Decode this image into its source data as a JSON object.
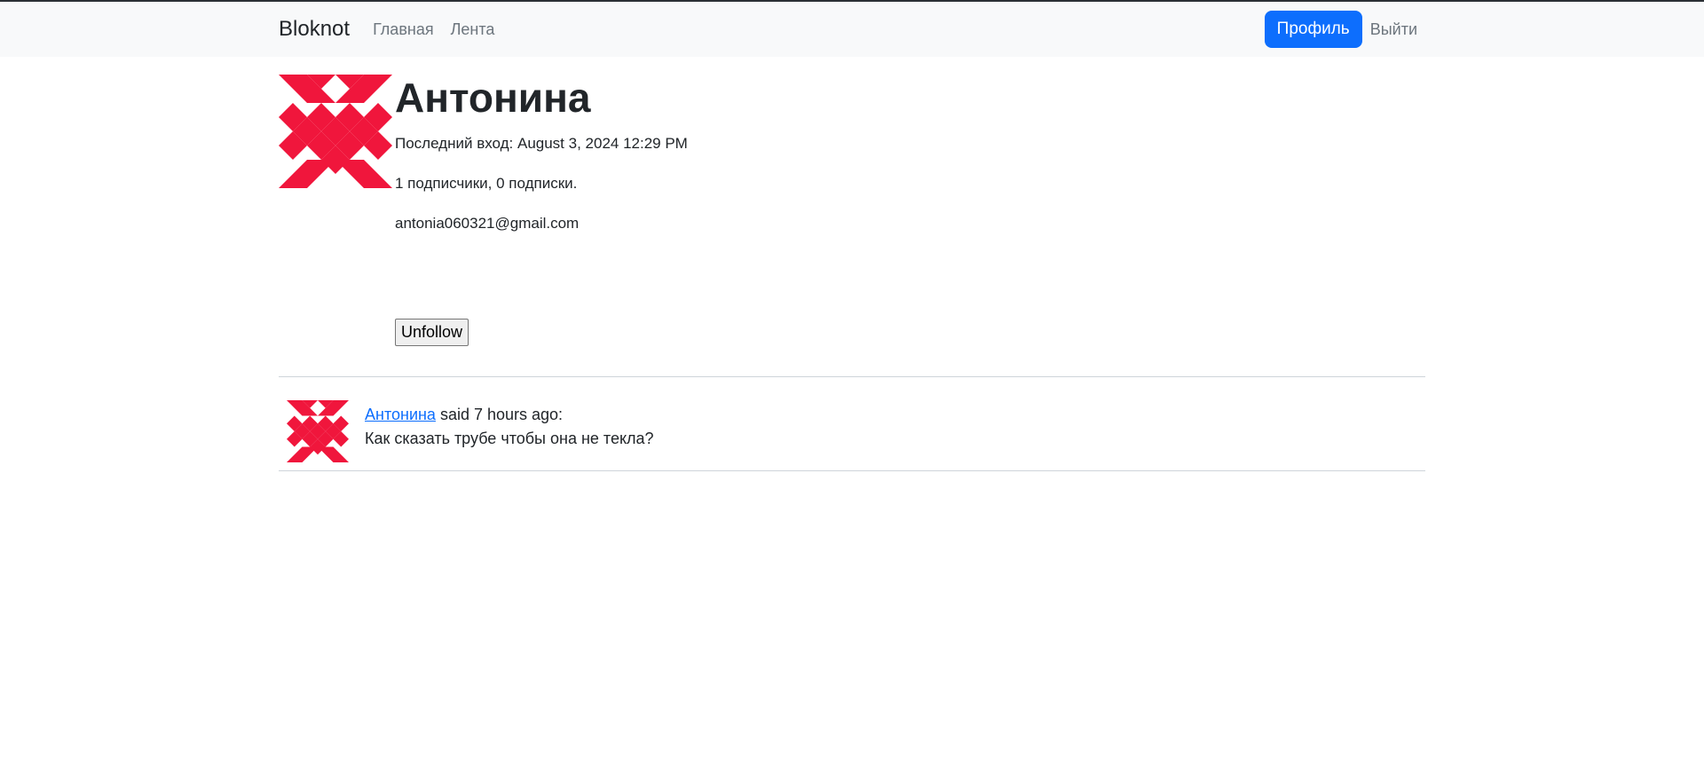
{
  "navbar": {
    "brand": "Bloknot",
    "links": [
      "Главная",
      "Лента"
    ],
    "profile_button": "Профиль",
    "logout": "Выйти"
  },
  "profile": {
    "name": "Антонина",
    "last_seen": "Последний вход: August 3, 2024 12:29 PM",
    "followers": "1 подписчики, 0 подписки.",
    "email": "antonia060321@gmail.com",
    "unfollow_label": "Unfollow",
    "avatar_icon": "identicon-avatar-icon"
  },
  "posts": [
    {
      "author": "Антонина",
      "said": "said 7 hours ago:",
      "text": "Как сказать трубе чтобы она не текла?"
    }
  ],
  "colors": {
    "accent": "#0d6efd",
    "identicon": "#f0163c",
    "navbar_bg": "#f8f9fa"
  }
}
